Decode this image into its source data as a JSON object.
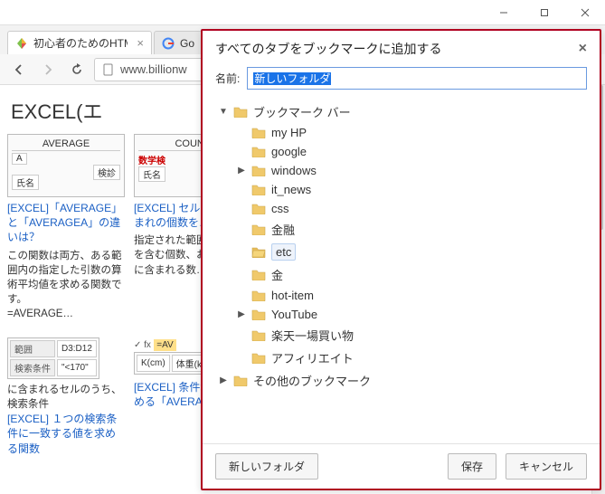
{
  "window": {
    "tabs": [
      {
        "title": "初心者のためのHTM",
        "active": true
      },
      {
        "title": "Go"
      }
    ],
    "address": "www.billionw"
  },
  "page": {
    "heading": "EXCEL(エ",
    "cards": [
      {
        "thumb_title": "AVERAGE",
        "thumb_cells": [
          "A",
          "検診",
          "氏名"
        ],
        "link": "[EXCEL]「AVERAGE」と「AVERAGEA」の違いは？",
        "desc": "この関数は両方、ある範囲内の指定した引数の算術平均値を求める関数です。",
        "tail": "=AVERAGE…"
      },
      {
        "thumb_title": "COUNT",
        "thumb_red": "数学検",
        "thumb_cells": [
          "氏名"
        ],
        "link": "[EXCEL] セル配列に含まれの個数を…",
        "desc": "指定された範囲れる数値を含む個数、および引トに含まれる数…"
      }
    ],
    "row2": {
      "left": {
        "rows": [
          [
            "範囲",
            "D3:D12"
          ],
          [
            "検索条件",
            "\"<170\""
          ]
        ],
        "caption": "に含まれるセルのうち、検索条件",
        "link": "[EXCEL] １つの検索条件に一致する値を求める関数"
      },
      "right": {
        "formula_prefix": "✓ fx",
        "formula": "=AV",
        "cells": [
          "K(cm)",
          "体重(k"
        ],
        "link": "[EXCEL] 条件均値を求める「AVERAGE"
      }
    }
  },
  "dialog": {
    "title": "すべてのタブをブックマークに追加する",
    "name_label": "名前:",
    "name_value": "新しいフォルダ",
    "tree": {
      "root": {
        "label": "ブックマーク バー",
        "children": [
          {
            "label": "my HP"
          },
          {
            "label": "google"
          },
          {
            "label": "windows",
            "expandable": true
          },
          {
            "label": "it_news"
          },
          {
            "label": "css"
          },
          {
            "label": "金融"
          },
          {
            "label": "etc",
            "selected": true,
            "open": true
          },
          {
            "label": "金"
          },
          {
            "label": "hot-item"
          },
          {
            "label": "YouTube",
            "expandable": true
          },
          {
            "label": "楽天一場買い物"
          },
          {
            "label": "アフィリエイト"
          }
        ]
      },
      "other": {
        "label": "その他のブックマーク",
        "expandable": true
      }
    },
    "buttons": {
      "new_folder": "新しいフォルダ",
      "save": "保存",
      "cancel": "キャンセル"
    }
  }
}
